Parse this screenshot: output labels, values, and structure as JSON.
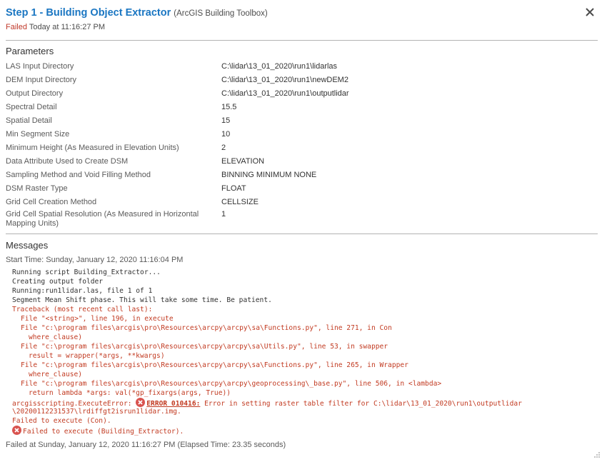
{
  "header": {
    "title": "Step 1 - Building Object Extractor",
    "subtitle": "(ArcGIS Building Toolbox)",
    "status": "Failed",
    "status_time": "Today at 11:16:27 PM"
  },
  "parameters": {
    "section_title": "Parameters",
    "rows": [
      {
        "name": "LAS Input Directory",
        "value": "C:\\lidar\\13_01_2020\\run1\\lidarlas"
      },
      {
        "name": "DEM Input Directory",
        "value": "C:\\lidar\\13_01_2020\\run1\\newDEM2"
      },
      {
        "name": "Output Directory",
        "value": "C:\\lidar\\13_01_2020\\run1\\outputlidar"
      },
      {
        "name": "Spectral Detail",
        "value": "15.5"
      },
      {
        "name": "Spatial Detail",
        "value": "15"
      },
      {
        "name": "Min Segment Size",
        "value": "10"
      },
      {
        "name": "Minimum Height (As Measured in Elevation Units)",
        "value": "2"
      },
      {
        "name": "Data Attribute Used to Create DSM",
        "value": "ELEVATION"
      },
      {
        "name": "Sampling Method and Void Filling Method",
        "value": "BINNING MINIMUM NONE"
      },
      {
        "name": "DSM Raster Type",
        "value": "FLOAT"
      },
      {
        "name": "Grid Cell Creation Method",
        "value": "CELLSIZE"
      },
      {
        "name": "Grid Cell Spatial Resolution (As Measured in Horizontal Mapping Units)",
        "value": "1"
      }
    ]
  },
  "messages": {
    "section_title": "Messages",
    "start_time": "Start Time: Sunday, January 12, 2020 11:16:04 PM",
    "log": [
      "Running script Building_Extractor...",
      "Creating output folder",
      "Running:run1lidar.las, file 1 of 1",
      "Segment Mean Shift phase. This will take some time. Be patient.",
      "Traceback (most recent call last):",
      "File \"<string>\", line 196, in execute",
      "File \"c:\\program files\\arcgis\\pro\\Resources\\arcpy\\arcpy\\sa\\Functions.py\", line 271, in Con",
      "where_clause)",
      "File \"c:\\program files\\arcgis\\pro\\Resources\\arcpy\\arcpy\\sa\\Utils.py\", line 53, in swapper",
      "result = wrapper(*args, **kwargs)",
      "File \"c:\\program files\\arcgis\\pro\\Resources\\arcpy\\arcpy\\sa\\Functions.py\", line 265, in Wrapper",
      "where_clause)",
      "File \"c:\\program files\\arcgis\\pro\\Resources\\arcpy\\arcpy\\geoprocessing\\_base.py\", line 506, in <lambda>",
      "return lambda *args: val(*gp_fixargs(args, True))"
    ],
    "exec_error_prefix": "arcgisscripting.ExecuteError: ",
    "error_code": "ERROR 010416:",
    "error_text": " Error in setting raster table filter for C:\\lidar\\13_01_2020\\run1\\outputlidar",
    "error_text_cont": "\\20200112231537\\lrdiffgt2isrun1lidar.img.",
    "failed_con": "Failed to execute (Con).",
    "failed_tool": "Failed to execute (Building_Extractor).",
    "failed_at": "Failed at Sunday, January 12, 2020 11:16:27 PM (Elapsed Time: 23.35 seconds)"
  },
  "icons": {
    "close": "close-icon",
    "error": "error-icon",
    "resize": "resize-grip-icon"
  },
  "colors": {
    "title": "#1a76c2",
    "error": "#c23b22",
    "error_icon": "#d9534f"
  }
}
